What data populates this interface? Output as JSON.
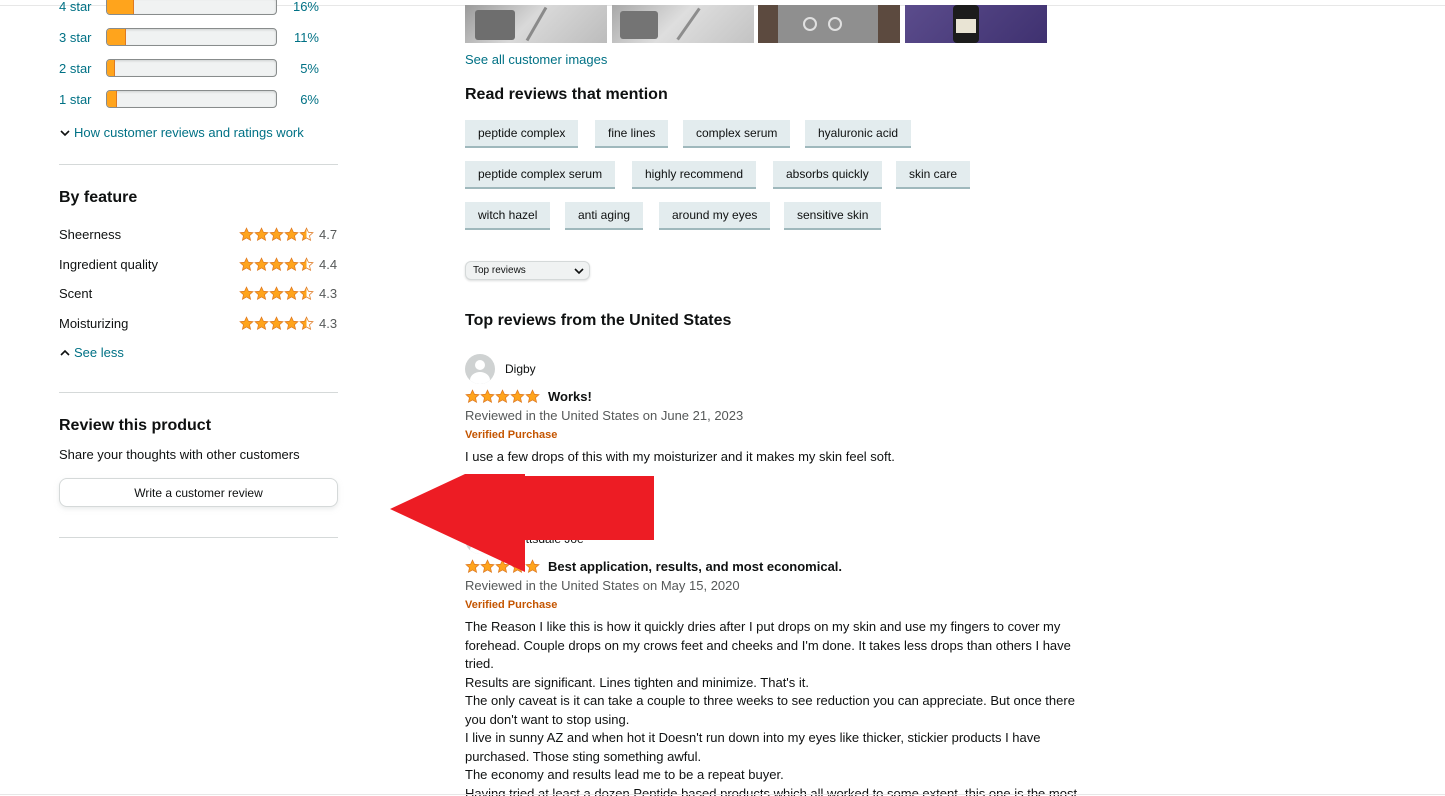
{
  "histogram": [
    {
      "label": "4 star",
      "pct": "16%",
      "value": 16
    },
    {
      "label": "3 star",
      "pct": "11%",
      "value": 11
    },
    {
      "label": "2 star",
      "pct": "5%",
      "value": 5
    },
    {
      "label": "1 star",
      "pct": "6%",
      "value": 6
    }
  ],
  "how_reviews_work": "How customer reviews and ratings work",
  "by_feature": {
    "title": "By feature",
    "items": [
      {
        "name": "Sheerness",
        "score": "4.7",
        "rating": 4.7
      },
      {
        "name": "Ingredient quality",
        "score": "4.4",
        "rating": 4.4
      },
      {
        "name": "Scent",
        "score": "4.3",
        "rating": 4.3
      },
      {
        "name": "Moisturizing",
        "score": "4.3",
        "rating": 4.3
      }
    ],
    "see_less": "See less"
  },
  "review_product": {
    "title": "Review this product",
    "subtitle": "Share your thoughts with other customers",
    "button": "Write a customer review"
  },
  "see_all_images": "See all customer images",
  "mentions": {
    "title": "Read reviews that mention",
    "chips": [
      "peptide complex",
      "fine lines",
      "complex serum",
      "hyaluronic acid",
      "peptide complex serum",
      "highly recommend",
      "absorbs quickly",
      "skin care",
      "witch hazel",
      "anti aging",
      "around my eyes",
      "sensitive skin"
    ]
  },
  "sort": {
    "selected": "Top reviews"
  },
  "top_reviews_title": "Top reviews from the United States",
  "reviews": [
    {
      "author": "Digby",
      "stars": 5,
      "title": "Works!",
      "meta": "Reviewed in the United States on June 21, 2023",
      "verified": "Verified Purchase",
      "body": [
        "I use a few drops of this with my moisturizer and it makes my skin feel soft."
      ]
    },
    {
      "author": "Scottsdale Joe",
      "stars": 5,
      "title": "Best application, results, and most economical.",
      "meta": "Reviewed in the United States on May 15, 2020",
      "verified": "Verified Purchase",
      "body": [
        "The Reason I like this is how it quickly dries after I put drops on my skin and use my fingers to cover my",
        "forehead. Couple drops on my crows feet and cheeks and I'm done. It takes less drops than others I have",
        "tried.",
        "Results are significant. Lines tighten and minimize. That's it.",
        "The only caveat is it can take a couple to three weeks to see reduction you can appreciate. But once there",
        "you don't want to stop using.",
        "I live in sunny AZ and when hot it Doesn't run down into my eyes like thicker, stickier products I have",
        "purchased. Those sting something awful.",
        "The economy and results lead me to be a repeat buyer.",
        "Having tried at least a dozen Peptide based products which all worked to some extent, this one is the most"
      ]
    }
  ],
  "colors": {
    "star": "#ffa41c",
    "link": "#007185",
    "verified": "#c45500",
    "arrow": "#ed1c24"
  }
}
